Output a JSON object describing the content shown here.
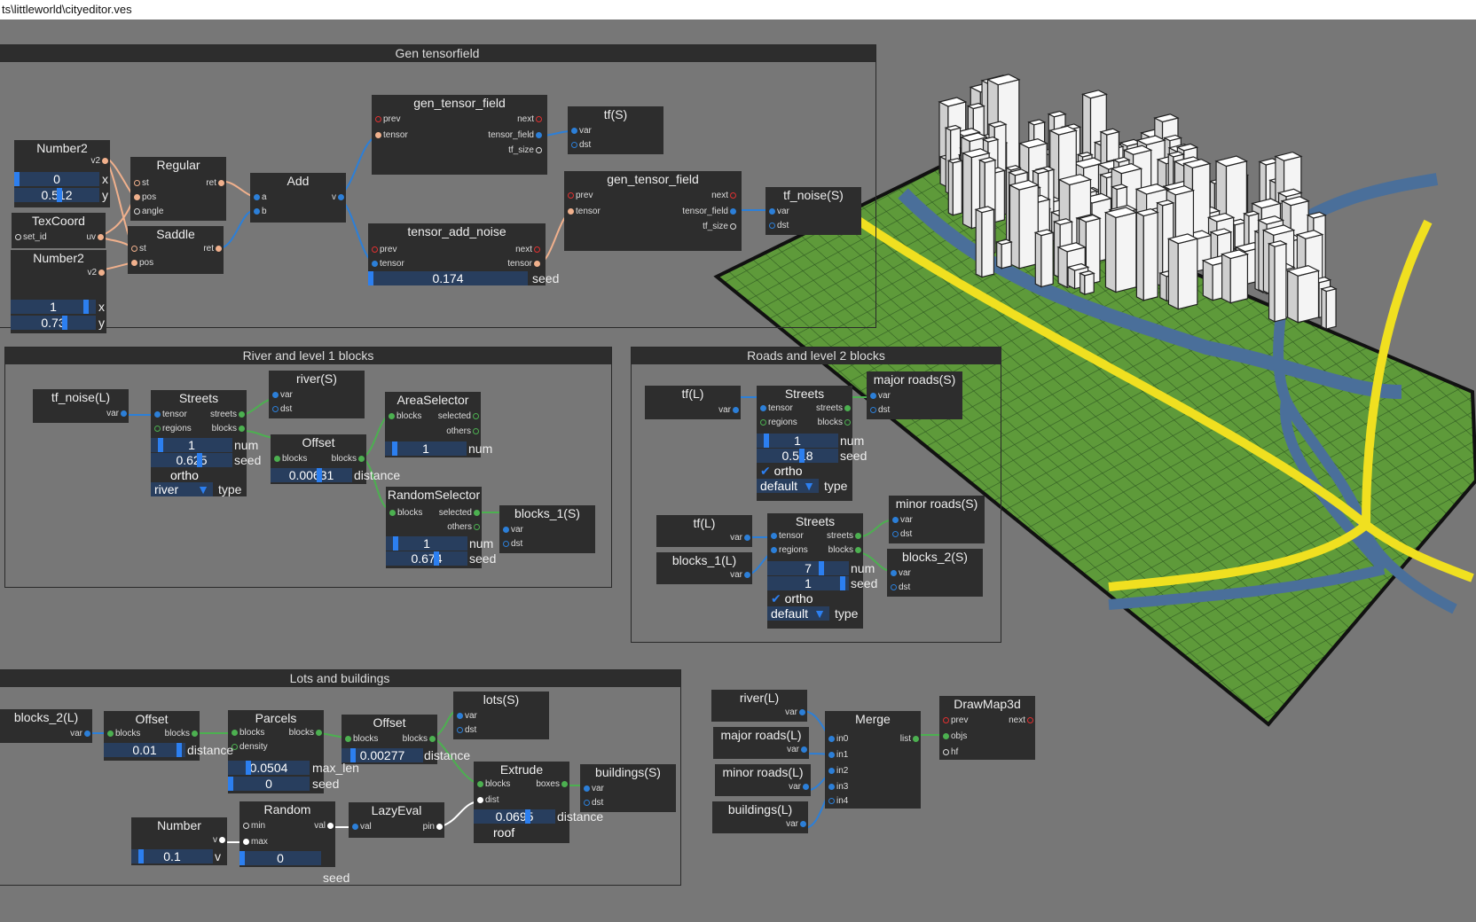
{
  "window": {
    "title": "ts\\littleworld\\cityeditor.ves"
  },
  "groups": {
    "gen_tensorfield": "Gen tensorfield",
    "river_level1": "River and level 1 blocks",
    "roads_level2": "Roads and level 2 blocks",
    "lots_buildings": "Lots and buildings"
  },
  "nodes": {
    "number2_a": {
      "title": "Number2",
      "out": "v2",
      "x_val": "0",
      "y_val": "0.512",
      "x_label": "x",
      "y_label": "y"
    },
    "texcoord": {
      "title": "TexCoord",
      "in": "set_id",
      "out": "uv"
    },
    "number2_b": {
      "title": "Number2",
      "out": "v2",
      "x_val": "1",
      "y_val": "0.73",
      "x_label": "x",
      "y_label": "y"
    },
    "regular": {
      "title": "Regular",
      "in1": "st",
      "in2": "pos",
      "in3": "angle",
      "out": "ret"
    },
    "saddle": {
      "title": "Saddle",
      "in1": "st",
      "in2": "pos",
      "out": "ret"
    },
    "add": {
      "title": "Add",
      "in1": "a",
      "in2": "b",
      "out": "v"
    },
    "gen_tensor_field_1": {
      "title": "gen_tensor_field",
      "in1": "prev",
      "in2": "tensor",
      "out1": "next",
      "out2": "tensor_field",
      "out3": "tf_size"
    },
    "tf_s": {
      "title": "tf(S)",
      "in1": "var",
      "in2": "dst"
    },
    "tensor_add_noise": {
      "title": "tensor_add_noise",
      "in1": "prev",
      "in2": "tensor",
      "out1": "next",
      "out2": "tensor",
      "seed_val": "0.174",
      "seed_label": "seed"
    },
    "gen_tensor_field_2": {
      "title": "gen_tensor_field",
      "in1": "prev",
      "in2": "tensor",
      "out1": "next",
      "out2": "tensor_field",
      "out3": "tf_size"
    },
    "tf_noise_s": {
      "title": "tf_noise(S)",
      "in1": "var",
      "in2": "dst"
    },
    "tf_noise_l": {
      "title": "tf_noise(L)",
      "out": "var"
    },
    "streets_1": {
      "title": "Streets",
      "in1": "tensor",
      "in2": "regions",
      "out1": "streets",
      "out2": "blocks",
      "num_val": "1",
      "num_label": "num",
      "seed_val": "0.625",
      "seed_label": "seed",
      "ortho": "ortho",
      "type_val": "river",
      "type_label": "type"
    },
    "river_s": {
      "title": "river(S)",
      "in1": "var",
      "in2": "dst"
    },
    "offset_1": {
      "title": "Offset",
      "in": "blocks",
      "out": "blocks",
      "dist_val": "0.00631",
      "dist_label": "distance"
    },
    "area_selector": {
      "title": "AreaSelector",
      "in": "blocks",
      "out1": "selected",
      "out2": "others",
      "num_val": "1",
      "num_label": "num"
    },
    "random_selector": {
      "title": "RandomSelector",
      "in": "blocks",
      "out1": "selected",
      "out2": "others",
      "num_val": "1",
      "num_label": "num",
      "seed_val": "0.674",
      "seed_label": "seed"
    },
    "blocks_1_s": {
      "title": "blocks_1(S)",
      "in1": "var",
      "in2": "dst"
    },
    "tf_l_1": {
      "title": "tf(L)",
      "out": "var"
    },
    "streets_2": {
      "title": "Streets",
      "in1": "tensor",
      "in2": "regions",
      "out1": "streets",
      "out2": "blocks",
      "num_val": "1",
      "num_label": "num",
      "seed_val": "0.518",
      "seed_label": "seed",
      "ortho": "ortho",
      "type_val": "default",
      "type_label": "type"
    },
    "major_roads_s": {
      "title": "major roads(S)",
      "in1": "var",
      "in2": "dst"
    },
    "tf_l_2": {
      "title": "tf(L)",
      "out": "var"
    },
    "blocks_1_l": {
      "title": "blocks_1(L)",
      "out": "var"
    },
    "streets_3": {
      "title": "Streets",
      "in1": "tensor",
      "in2": "regions",
      "out1": "streets",
      "out2": "blocks",
      "num_val": "7",
      "num_label": "num",
      "seed_val": "1",
      "seed_label": "seed",
      "ortho": "ortho",
      "type_val": "default",
      "type_label": "type"
    },
    "minor_roads_s": {
      "title": "minor roads(S)",
      "in1": "var",
      "in2": "dst"
    },
    "blocks_2_s": {
      "title": "blocks_2(S)",
      "in1": "var",
      "in2": "dst"
    },
    "blocks_2_l": {
      "title": "blocks_2(L)",
      "out": "var"
    },
    "offset_2": {
      "title": "Offset",
      "in": "blocks",
      "out": "blocks",
      "dist_val": "0.01",
      "dist_label": "distance"
    },
    "parcels": {
      "title": "Parcels",
      "in1": "blocks",
      "in2": "density",
      "out": "blocks",
      "maxlen_val": "0.0504",
      "maxlen_label": "max_len",
      "seed_val": "0",
      "seed_label": "seed"
    },
    "offset_3": {
      "title": "Offset",
      "in": "blocks",
      "out": "blocks",
      "dist_val": "0.00277",
      "dist_label": "distance"
    },
    "lots_s": {
      "title": "lots(S)",
      "in1": "var",
      "in2": "dst"
    },
    "extrude": {
      "title": "Extrude",
      "in1": "blocks",
      "in2": "dist",
      "out": "boxes",
      "dist_val": "0.0695",
      "dist_label": "distance",
      "roof": "roof"
    },
    "buildings_s": {
      "title": "buildings(S)",
      "in1": "var",
      "in2": "dst"
    },
    "number": {
      "title": "Number",
      "out": "v",
      "val": "0.1",
      "val_label": "v"
    },
    "random": {
      "title": "Random",
      "in1": "min",
      "in2": "max",
      "out": "val",
      "seed_val": "0",
      "seed_label": "seed"
    },
    "lazy_eval": {
      "title": "LazyEval",
      "in": "val",
      "out": "pin"
    },
    "river_l": {
      "title": "river(L)",
      "out": "var"
    },
    "major_roads_l": {
      "title": "major roads(L)",
      "out": "var"
    },
    "minor_roads_l": {
      "title": "minor roads(L)",
      "out": "var"
    },
    "buildings_l": {
      "title": "buildings(L)",
      "out": "var"
    },
    "merge": {
      "title": "Merge",
      "in0": "in0",
      "in1": "in1",
      "in2": "in2",
      "in3": "in3",
      "in4": "in4",
      "out": "list"
    },
    "drawmap3d": {
      "title": "DrawMap3d",
      "in1": "prev",
      "in2": "objs",
      "in3": "hf",
      "out": "next"
    }
  },
  "colors": {
    "bg": "#777777",
    "node": "#2d2d2d",
    "field": "#283e5e",
    "bar": "#2c7ff0",
    "pin_blue": "#2c7fd8",
    "pin_green": "#4cb050",
    "pin_peach": "#f0b08c",
    "pin_red": "#e03030",
    "ground": "#5e9a3a",
    "river": "#4a6f9a",
    "road": "#f0e020"
  }
}
